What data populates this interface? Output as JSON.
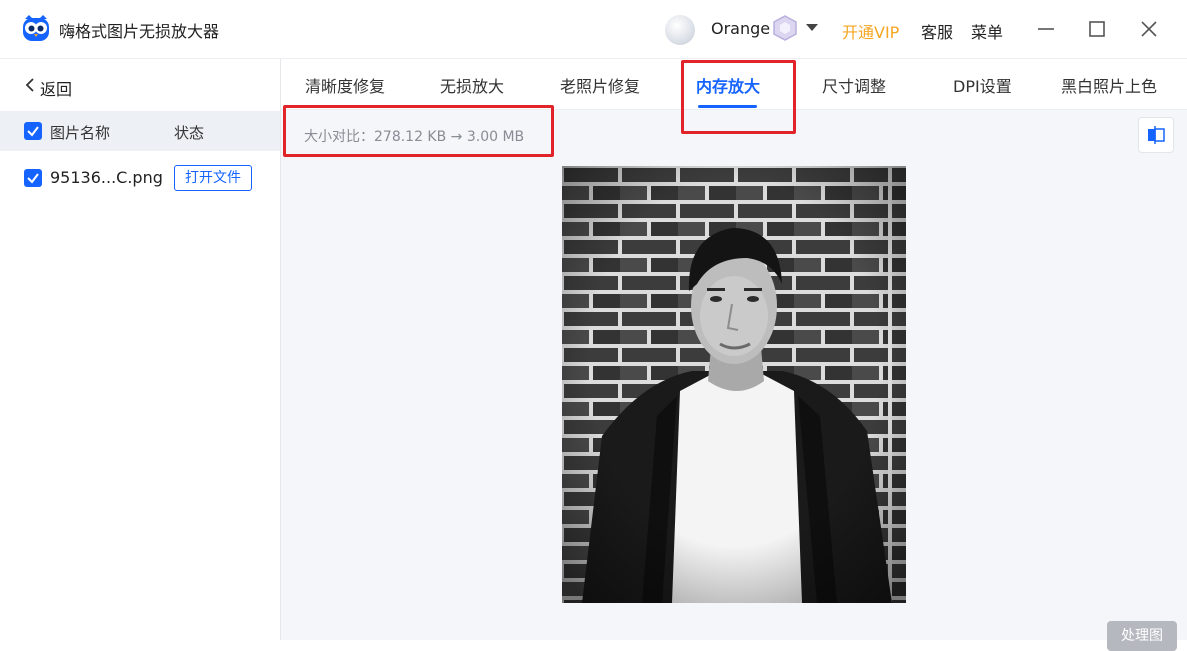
{
  "app": {
    "title": "嗨格式图片无损放大器",
    "logo_icon": "owl-logo-icon"
  },
  "account": {
    "username": "Orange",
    "vip_link": "开通VIP",
    "service_link": "客服",
    "menu_link": "菜单"
  },
  "sidebar": {
    "back_label": "返回",
    "columns": {
      "name": "图片名称",
      "status": "状态"
    },
    "files": [
      {
        "name": "95136...C.png",
        "action": "打开文件",
        "checked": true
      }
    ]
  },
  "tabs": [
    {
      "label": "清晰度修复",
      "active": false
    },
    {
      "label": "无损放大",
      "active": false
    },
    {
      "label": "老照片修复",
      "active": false
    },
    {
      "label": "内存放大",
      "active": true
    },
    {
      "label": "尺寸调整",
      "active": false
    },
    {
      "label": "DPI设置",
      "active": false
    },
    {
      "label": "黑白照片上色",
      "active": false
    }
  ],
  "main": {
    "size_compare": "大小对比：278.12 KB → 3.00 MB",
    "process_button": "处理图"
  },
  "colors": {
    "accent": "#1664ff",
    "vip": "#f5a623",
    "annotation": "#e0242a"
  }
}
